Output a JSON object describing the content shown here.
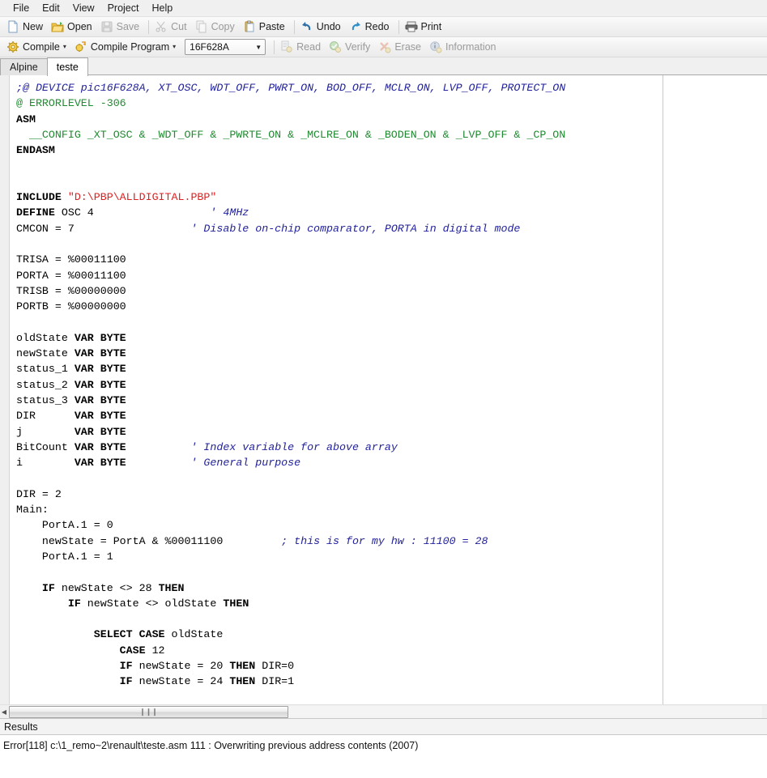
{
  "menubar": {
    "items": [
      {
        "label": "File"
      },
      {
        "label": "Edit"
      },
      {
        "label": "View"
      },
      {
        "label": "Project"
      },
      {
        "label": "Help"
      }
    ]
  },
  "toolbar_main": {
    "buttons": [
      {
        "label": "New",
        "icon": "new-file-icon",
        "enabled": true
      },
      {
        "label": "Open",
        "icon": "open-folder-icon",
        "enabled": true
      },
      {
        "label": "Save",
        "icon": "save-disk-icon",
        "enabled": false
      },
      {
        "label": "Cut",
        "icon": "scissors-icon",
        "enabled": false
      },
      {
        "label": "Copy",
        "icon": "copy-icon",
        "enabled": false
      },
      {
        "label": "Paste",
        "icon": "clipboard-icon",
        "enabled": true
      },
      {
        "label": "Undo",
        "icon": "undo-arrow-icon",
        "enabled": true
      },
      {
        "label": "Redo",
        "icon": "redo-arrow-icon",
        "enabled": true
      },
      {
        "label": "Print",
        "icon": "printer-icon",
        "enabled": true
      }
    ]
  },
  "toolbar_compile": {
    "compile": {
      "label": "Compile",
      "icon": "gear-yellow-icon",
      "dropdown": "▾"
    },
    "compile_program": {
      "label": "Compile Program",
      "icon": "gear-arrow-icon",
      "dropdown": "▾"
    },
    "device_select": {
      "value": "16F628A",
      "arrow": "▼"
    },
    "buttons": [
      {
        "label": "Read",
        "icon": "read-chip-icon",
        "enabled": false
      },
      {
        "label": "Verify",
        "icon": "verify-check-icon",
        "enabled": false
      },
      {
        "label": "Erase",
        "icon": "erase-x-icon",
        "enabled": false
      },
      {
        "label": "Information",
        "icon": "info-icon",
        "enabled": false
      }
    ]
  },
  "tabs": [
    {
      "label": "Alpine",
      "active": false
    },
    {
      "label": "teste",
      "active": true
    }
  ],
  "editor": {
    "lines": [
      [
        {
          "t": ";@ DEVICE pic16F628A, XT_OSC, WDT_OFF, PWRT_ON, BOD_OFF, MCLR_ON, LVP_OFF, PROTECT_ON",
          "c": "cmt-blue"
        }
      ],
      [
        {
          "t": "@ ERRORLEVEL -306",
          "c": "cmt-green"
        }
      ],
      [
        {
          "t": "ASM",
          "c": "kw"
        }
      ],
      [
        {
          "t": "  __CONFIG _XT_OSC & _WDT_OFF & _PWRTE_ON & _MCLRE_ON & _BODEN_ON & _LVP_OFF & _CP_ON",
          "c": "cmt-green"
        }
      ],
      [
        {
          "t": "ENDASM",
          "c": "kw"
        }
      ],
      [],
      [],
      [
        {
          "t": "INCLUDE ",
          "c": "kw"
        },
        {
          "t": "\"D:\\PBP\\ALLDIGITAL.PBP\"",
          "c": "str"
        }
      ],
      [
        {
          "t": "DEFINE",
          "c": "kw"
        },
        {
          "t": " OSC 4                  ",
          "c": "plain"
        },
        {
          "t": "' 4MHz",
          "c": "cmt-blue"
        }
      ],
      [
        {
          "t": "CMCON = 7                  ",
          "c": "plain"
        },
        {
          "t": "' Disable on-chip comparator, PORTA in digital mode",
          "c": "cmt-blue"
        }
      ],
      [],
      [
        {
          "t": "TRISA = %00011100",
          "c": "plain"
        }
      ],
      [
        {
          "t": "PORTA = %00011100",
          "c": "plain"
        }
      ],
      [
        {
          "t": "TRISB = %00000000",
          "c": "plain"
        }
      ],
      [
        {
          "t": "PORTB = %00000000",
          "c": "plain"
        }
      ],
      [],
      [
        {
          "t": "oldState ",
          "c": "plain"
        },
        {
          "t": "VAR BYTE",
          "c": "kw"
        }
      ],
      [
        {
          "t": "newState ",
          "c": "plain"
        },
        {
          "t": "VAR BYTE",
          "c": "kw"
        }
      ],
      [
        {
          "t": "status_1 ",
          "c": "plain"
        },
        {
          "t": "VAR BYTE",
          "c": "kw"
        }
      ],
      [
        {
          "t": "status_2 ",
          "c": "plain"
        },
        {
          "t": "VAR BYTE",
          "c": "kw"
        }
      ],
      [
        {
          "t": "status_3 ",
          "c": "plain"
        },
        {
          "t": "VAR BYTE",
          "c": "kw"
        }
      ],
      [
        {
          "t": "DIR      ",
          "c": "plain"
        },
        {
          "t": "VAR BYTE",
          "c": "kw"
        }
      ],
      [
        {
          "t": "j        ",
          "c": "plain"
        },
        {
          "t": "VAR BYTE",
          "c": "kw"
        }
      ],
      [
        {
          "t": "BitCount ",
          "c": "plain"
        },
        {
          "t": "VAR BYTE",
          "c": "kw"
        },
        {
          "t": "          ",
          "c": "plain"
        },
        {
          "t": "' Index variable for above array",
          "c": "cmt-blue"
        }
      ],
      [
        {
          "t": "i        ",
          "c": "plain"
        },
        {
          "t": "VAR BYTE",
          "c": "kw"
        },
        {
          "t": "          ",
          "c": "plain"
        },
        {
          "t": "' General purpose",
          "c": "cmt-blue"
        }
      ],
      [],
      [
        {
          "t": "DIR = 2",
          "c": "plain"
        }
      ],
      [
        {
          "t": "Main:",
          "c": "plain"
        }
      ],
      [
        {
          "t": "    PortA.1 = 0",
          "c": "plain"
        }
      ],
      [
        {
          "t": "    newState = PortA & %00011100         ",
          "c": "plain"
        },
        {
          "t": "; this is for my hw : 11100 = 28",
          "c": "cmt-blue"
        }
      ],
      [
        {
          "t": "    PortA.1 = 1",
          "c": "plain"
        }
      ],
      [],
      [
        {
          "t": "    ",
          "c": "plain"
        },
        {
          "t": "IF",
          "c": "kw"
        },
        {
          "t": " newState <> 28 ",
          "c": "plain"
        },
        {
          "t": "THEN",
          "c": "kw"
        }
      ],
      [
        {
          "t": "        ",
          "c": "plain"
        },
        {
          "t": "IF",
          "c": "kw"
        },
        {
          "t": " newState <> oldState ",
          "c": "plain"
        },
        {
          "t": "THEN",
          "c": "kw"
        }
      ],
      [],
      [
        {
          "t": "            ",
          "c": "plain"
        },
        {
          "t": "SELECT CASE",
          "c": "kw"
        },
        {
          "t": " oldState",
          "c": "plain"
        }
      ],
      [
        {
          "t": "                ",
          "c": "plain"
        },
        {
          "t": "CASE",
          "c": "kw"
        },
        {
          "t": " 12",
          "c": "plain"
        }
      ],
      [
        {
          "t": "                ",
          "c": "plain"
        },
        {
          "t": "IF",
          "c": "kw"
        },
        {
          "t": " newState = 20 ",
          "c": "plain"
        },
        {
          "t": "THEN",
          "c": "kw"
        },
        {
          "t": " DIR=0",
          "c": "plain"
        }
      ],
      [
        {
          "t": "                ",
          "c": "plain"
        },
        {
          "t": "IF",
          "c": "kw"
        },
        {
          "t": " newState = 24 ",
          "c": "plain"
        },
        {
          "t": "THEN",
          "c": "kw"
        },
        {
          "t": " DIR=1",
          "c": "plain"
        }
      ]
    ]
  },
  "hscrollbar": {
    "left_arrow": "◀",
    "grip": "❙❙❙"
  },
  "results": {
    "header": "Results",
    "lines": [
      "Error[118] c:\\1_remo~2\\renault\\teste.asm 111 : Overwriting previous address contents (2007)"
    ]
  },
  "colors": {
    "comment_blue": "#22229c",
    "comment_green": "#1f8a2f",
    "string_red": "#e02020",
    "keyword": "#000000",
    "chrome": "#f0f0f0"
  }
}
